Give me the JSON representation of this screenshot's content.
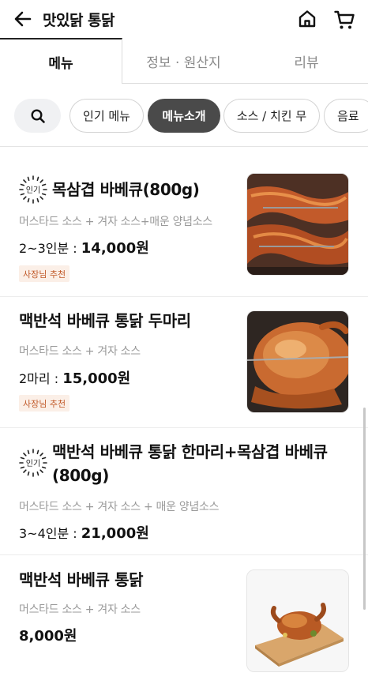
{
  "header": {
    "title": "맛있닭 통닭",
    "back_icon": "arrow-left-icon",
    "home_icon": "home-icon",
    "cart_icon": "cart-icon"
  },
  "tabs": [
    {
      "label": "메뉴",
      "active": true
    },
    {
      "label": "정보 · 원산지",
      "active": false
    },
    {
      "label": "리뷰",
      "active": false
    }
  ],
  "chips": {
    "search_icon": "search-icon",
    "items": [
      {
        "label": "인기 메뉴",
        "active": false
      },
      {
        "label": "메뉴소개",
        "active": true
      },
      {
        "label": "소스 / 치킨 무",
        "active": false
      },
      {
        "label": "음료",
        "active": false
      }
    ]
  },
  "popular_badge_text": "인기",
  "menu_items": [
    {
      "name": "목삼겹 바베큐(800g)",
      "popular": true,
      "description": "머스타드 소스 + 겨자 소스+매운 양념소스",
      "price_prefix": "2~3인분 : ",
      "price": "14,000원",
      "badge": "사장님 추천",
      "has_image": true
    },
    {
      "name": "맥반석 바베큐 통닭 두마리",
      "popular": false,
      "description": "머스타드 소스 + 겨자 소스",
      "price_prefix": "2마리 : ",
      "price": "15,000원",
      "badge": "사장님 추천",
      "has_image": true
    },
    {
      "name_line1": "맥반석 바베큐 통닭 한마리+목삼겹 바베큐",
      "name_line2": "(800g)",
      "popular": true,
      "description": "머스타드 소스 + 겨자 소스 + 매운 양념소스",
      "price_prefix": "3~4인분 : ",
      "price": "21,000원",
      "has_image": false
    },
    {
      "name": "맥반석 바베큐 통닭",
      "popular": false,
      "description": "머스타드 소스 + 겨자 소스",
      "price": "8,000원",
      "has_image": true
    }
  ],
  "colors": {
    "active_chip_bg": "#4a4a4a",
    "badge_bg": "#fbefe7",
    "badge_text": "#c15a2a",
    "desc_text": "#9a9a9a"
  }
}
